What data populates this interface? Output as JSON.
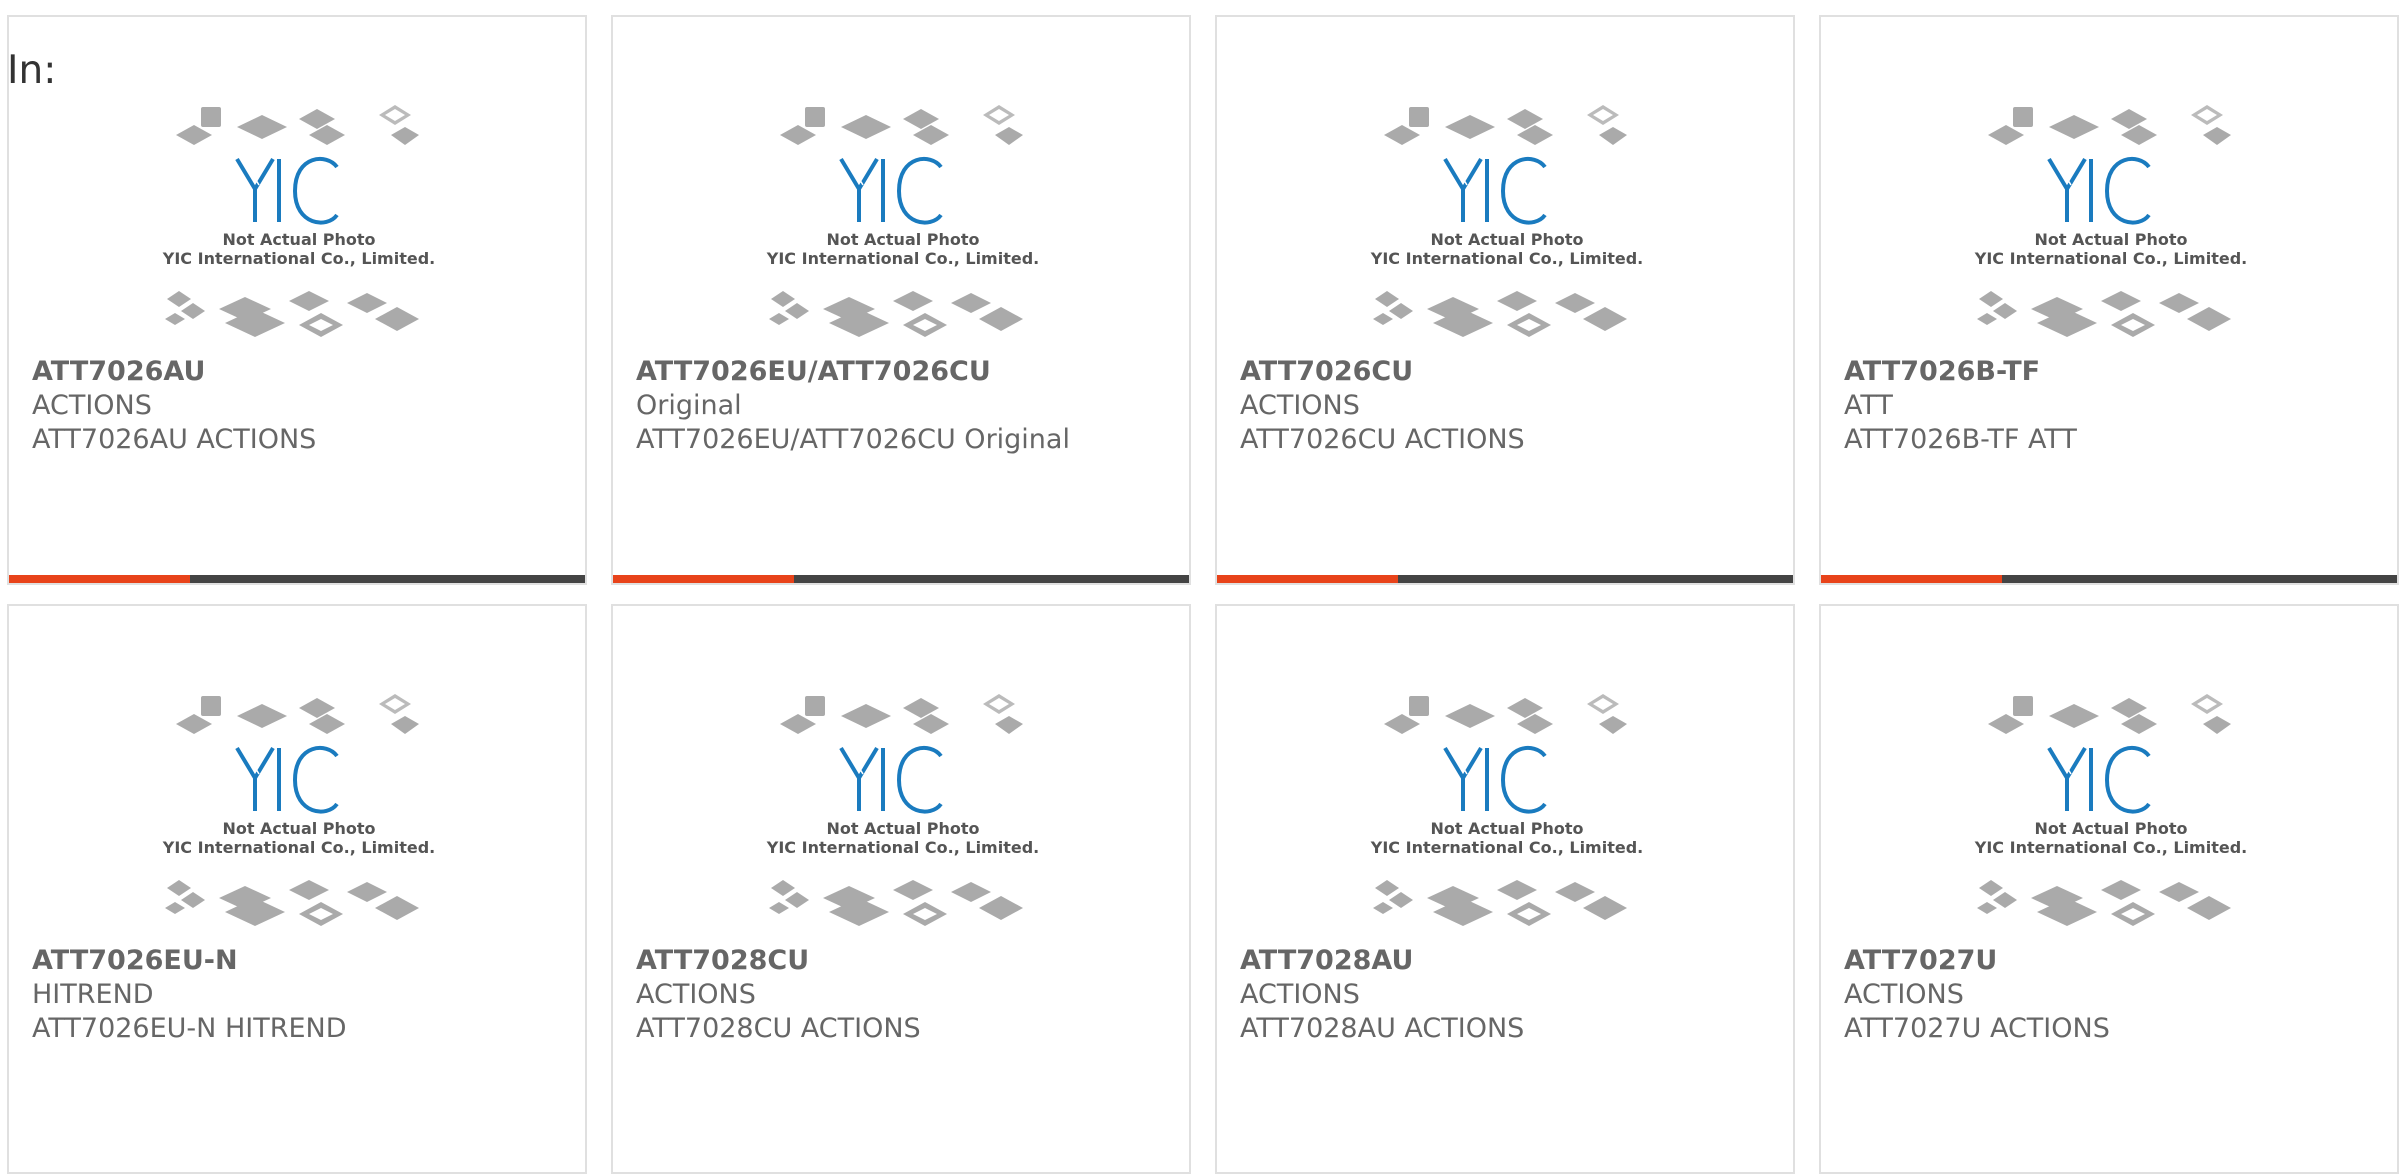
{
  "header": {
    "label": "In:"
  },
  "image_overlay": {
    "logo": "YIC",
    "line1": "Not Actual Photo",
    "line2": "YIC International Co., Limited."
  },
  "colors": {
    "accent": "#e8431a",
    "bar": "#444444",
    "logo_blue": "#1a7bbf",
    "chip_grey": "#aaaaaa"
  },
  "products": [
    {
      "part": "ATT7026AU",
      "brand": "ACTIONS",
      "desc": "ATT7026AU ACTIONS"
    },
    {
      "part": "ATT7026EU/ATT7026CU",
      "brand": "Original",
      "desc": "ATT7026EU/ATT7026CU Original"
    },
    {
      "part": "ATT7026CU",
      "brand": "ACTIONS",
      "desc": "ATT7026CU ACTIONS"
    },
    {
      "part": "ATT7026B-TF",
      "brand": "ATT",
      "desc": "ATT7026B-TF ATT"
    },
    {
      "part": "ATT7026EU-N",
      "brand": "HITREND",
      "desc": "ATT7026EU-N HITREND"
    },
    {
      "part": "ATT7028CU",
      "brand": "ACTIONS",
      "desc": "ATT7028CU ACTIONS"
    },
    {
      "part": "ATT7028AU",
      "brand": "ACTIONS",
      "desc": "ATT7028AU ACTIONS"
    },
    {
      "part": "ATT7027U",
      "brand": "ACTIONS",
      "desc": "ATT7027U ACTIONS"
    }
  ]
}
